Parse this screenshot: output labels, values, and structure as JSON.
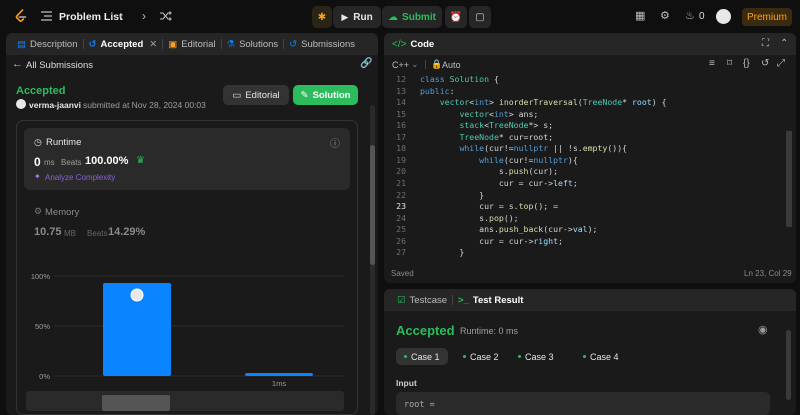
{
  "topbar": {
    "problem_list": "Problem List",
    "run": "Run",
    "submit": "Submit",
    "streak": "0",
    "premium": "Premium"
  },
  "left_tabs": [
    {
      "label": "Description"
    },
    {
      "label": "Accepted"
    },
    {
      "label": "Editorial"
    },
    {
      "label": "Solutions"
    },
    {
      "label": "Submissions"
    }
  ],
  "submission": {
    "back_label": "All Submissions",
    "status": "Accepted",
    "user": "verma-jaanvi",
    "submitted_text": "submitted at Nov 28, 2024 00:03",
    "editorial_btn": "Editorial",
    "solution_btn": "Solution"
  },
  "runtime": {
    "title": "Runtime",
    "value": "0",
    "unit": "ms",
    "beats_label": "Beats",
    "beats": "100.00%",
    "analyze": "Analyze Complexity"
  },
  "memory": {
    "title": "Memory",
    "value": "10.75",
    "unit": "MB",
    "beats_label": "Beats",
    "beats": "14.29%"
  },
  "chart_data": {
    "type": "bar",
    "categories": [
      "",
      "1ms"
    ],
    "values": [
      93,
      3
    ],
    "y_ticks": [
      "100%",
      "50%",
      "0%"
    ],
    "ylim": [
      0,
      100
    ],
    "bar_color": "#0a84ff"
  },
  "code": {
    "title": "Code",
    "language": "C++",
    "mode": "Auto",
    "status": "Saved",
    "position": "Ln 23, Col 29",
    "lines": [
      {
        "n": "12",
        "html": "<span class=\"kw\">class</span> <span class=\"ty\">Solution</span> {"
      },
      {
        "n": "13",
        "html": "<span class=\"kw\">public</span>:"
      },
      {
        "n": "14",
        "html": "    <span class=\"ty\">vector</span>&lt;<span class=\"kw\">int</span>&gt; <span class=\"fn\">inorderTraversal</span>(<span class=\"ty\">TreeNode</span>* <span class=\"bl\">root</span>) {"
      },
      {
        "n": "15",
        "html": "        <span class=\"ty\">vector</span>&lt;<span class=\"kw\">int</span>&gt; ans;"
      },
      {
        "n": "16",
        "html": "        <span class=\"ty\">stack</span>&lt;<span class=\"ty\">TreeNode</span>*&gt; s;"
      },
      {
        "n": "17",
        "html": "        <span class=\"ty\">TreeNode</span>* cur=root;"
      },
      {
        "n": "18",
        "html": "        <span class=\"kw\">while</span>(cur!=<span class=\"kw\">nullptr</span> || !s.<span class=\"fn\">empty</span>()){"
      },
      {
        "n": "19",
        "html": "            <span class=\"kw\">while</span>(cur!=<span class=\"kw\">nullptr</span>){"
      },
      {
        "n": "20",
        "html": "                s.<span class=\"fn\">push</span>(cur);"
      },
      {
        "n": "21",
        "html": "                cur = cur-&gt;<span class=\"bl\">left</span>;"
      },
      {
        "n": "22",
        "html": "            }"
      },
      {
        "n": "23",
        "html": "            cur = s.<span class=\"fn\">top</span>(); ="
      },
      {
        "n": "24",
        "html": "            s.<span class=\"fn\">pop</span>();"
      },
      {
        "n": "25",
        "html": "            ans.<span class=\"fn\">push_back</span>(cur-&gt;<span class=\"bl\">val</span>);"
      },
      {
        "n": "26",
        "html": "            cur = cur-&gt;<span class=\"bl\">right</span>;"
      },
      {
        "n": "27",
        "html": "        }"
      }
    ]
  },
  "result": {
    "tab_testcase": "Testcase",
    "tab_result": "Test Result",
    "status": "Accepted",
    "runtime_text": "Runtime: 0 ms",
    "cases": [
      "Case 1",
      "Case 2",
      "Case 3",
      "Case 4"
    ],
    "input_label": "Input",
    "input_value": "root ="
  }
}
